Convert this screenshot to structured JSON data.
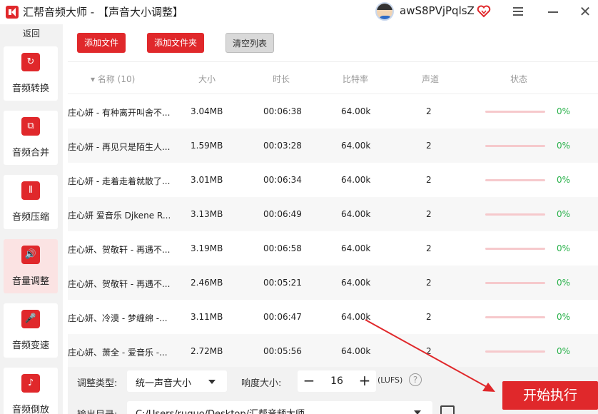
{
  "app": {
    "title": "汇帮音频大师 - 【声音大小调整】",
    "username": "awS8PVjPqlsZ",
    "close_glyph": "✕"
  },
  "sidebar": {
    "back_label": "返回",
    "items": [
      {
        "label": "音频转换",
        "icon": "audio-convert-icon",
        "glyph": "↻",
        "active": false
      },
      {
        "label": "音频合并",
        "icon": "audio-merge-icon",
        "glyph": "⧉",
        "active": false
      },
      {
        "label": "音频压缩",
        "icon": "audio-compress-icon",
        "glyph": "⦀",
        "active": false
      },
      {
        "label": "音量调整",
        "icon": "volume-icon",
        "glyph": "🔊",
        "active": true
      },
      {
        "label": "音频变速",
        "icon": "microphone-icon",
        "glyph": "🎤",
        "active": false
      },
      {
        "label": "音频倒放",
        "icon": "music-note-icon",
        "glyph": "♪",
        "active": false
      }
    ]
  },
  "toolbar": {
    "add_file": "添加文件",
    "add_folder": "添加文件夹",
    "clear_list": "清空列表"
  },
  "table": {
    "headers": {
      "name": "▾ 名称 (10)",
      "size": "大小",
      "duration": "时长",
      "bitrate": "比特率",
      "channels": "声道",
      "status": "状态"
    },
    "rows": [
      {
        "name": "庄心妍 - 有种离开叫舍不...",
        "size": "3.04MB",
        "duration": "00:06:38",
        "bitrate": "64.00k",
        "channels": "2",
        "progress": 0,
        "status": "0%"
      },
      {
        "name": "庄心妍 - 再见只是陌生人...",
        "size": "1.59MB",
        "duration": "00:03:28",
        "bitrate": "64.00k",
        "channels": "2",
        "progress": 0,
        "status": "0%"
      },
      {
        "name": "庄心妍 - 走着走着就散了...",
        "size": "3.01MB",
        "duration": "00:06:34",
        "bitrate": "64.00k",
        "channels": "2",
        "progress": 0,
        "status": "0%"
      },
      {
        "name": "庄心妍 爱音乐 Djkene R...",
        "size": "3.13MB",
        "duration": "00:06:49",
        "bitrate": "64.00k",
        "channels": "2",
        "progress": 0,
        "status": "0%"
      },
      {
        "name": "庄心妍、贺敬轩 - 再遇不...",
        "size": "3.19MB",
        "duration": "00:06:58",
        "bitrate": "64.00k",
        "channels": "2",
        "progress": 0,
        "status": "0%"
      },
      {
        "name": "庄心妍、贺敬轩 - 再遇不...",
        "size": "2.46MB",
        "duration": "00:05:21",
        "bitrate": "64.00k",
        "channels": "2",
        "progress": 0,
        "status": "0%"
      },
      {
        "name": "庄心妍、冷漠 - 梦缠绵 -...",
        "size": "3.11MB",
        "duration": "00:06:47",
        "bitrate": "64.00k",
        "channels": "2",
        "progress": 0,
        "status": "0%"
      },
      {
        "name": "庄心妍、萧全 - 爱音乐 -...",
        "size": "2.72MB",
        "duration": "00:05:56",
        "bitrate": "64.00k",
        "channels": "2",
        "progress": 0,
        "status": "0%"
      }
    ]
  },
  "settings": {
    "type_label": "调整类型:",
    "type_value": "统一声音大小",
    "loudness_label": "响度大小:",
    "loudness_value": "16",
    "minus": "−",
    "plus": "+",
    "unit": "(LUFS)",
    "help": "?",
    "output_label": "输出目录:",
    "output_path": "C:/Users/ruguo/Desktop/汇帮音频大师",
    "start": "开始执行"
  },
  "colors": {
    "accent": "#e0282b",
    "status_green": "#2bb24c",
    "progress_track": "#f6c9cc"
  }
}
